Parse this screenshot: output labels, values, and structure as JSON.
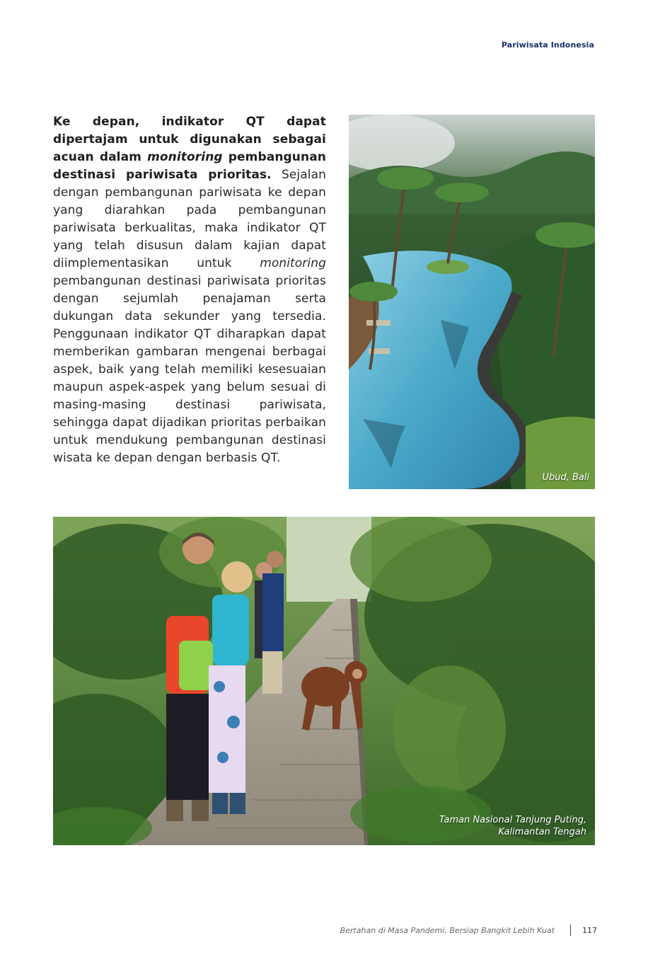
{
  "header": {
    "running_head": "Pariwisata Indonesia"
  },
  "article": {
    "lead_1": "Ke depan, indikator QT dapat dipertajam untuk digunakan sebagai acuan dalam ",
    "lead_italic": "monitoring",
    "lead_2": " pembangunan destinasi pariwisata prioritas.",
    "body_1": " Sejalan dengan pembangunan pariwisata ke depan yang diarahkan pada pembangunan pariwisata berkualitas, maka indikator QT yang telah disusun dalam kajian dapat diimplementasikan untuk ",
    "body_italic": "monitoring",
    "body_2": " pembangunan destinasi pariwisata prioritas dengan sejumlah penajaman serta dukungan data sekunder yang tersedia. Penggunaan indikator QT diharapkan dapat memberikan gambaran mengenai berbagai aspek, baik yang telah memiliki kesesuaian maupun aspek-aspek yang belum sesuai di masing-masing destinasi pariwisata, sehingga dapat dijadikan prioritas perbaikan untuk mendukung pembangunan destinasi wisata ke depan dengan berbasis QT."
  },
  "photos": {
    "ubud": {
      "caption": "Ubud, Bali"
    },
    "tanjung": {
      "caption_line1": "Taman Nasional Tanjung Puting,",
      "caption_line2": "Kalimantan Tengah"
    }
  },
  "footer": {
    "book_title": "Bertahan di Masa Pandemi, Bersiap Bangkit Lebih Kuat",
    "page_number": "117"
  },
  "colors": {
    "running_head": "#1c2f6b",
    "text": "#2a2a2a"
  }
}
